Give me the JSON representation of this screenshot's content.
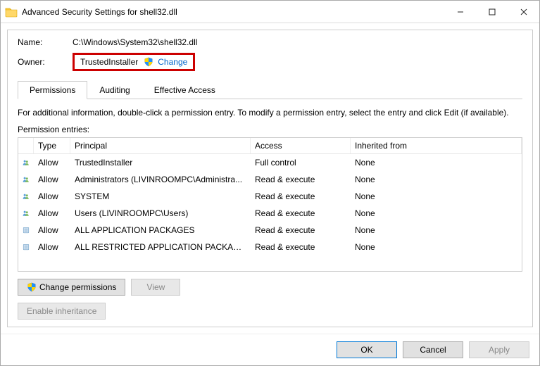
{
  "window": {
    "title": "Advanced Security Settings for shell32.dll"
  },
  "fields": {
    "name_label": "Name:",
    "name_value": "C:\\Windows\\System32\\shell32.dll",
    "owner_label": "Owner:",
    "owner_value": "TrustedInstaller",
    "change_link": "Change"
  },
  "tabs": {
    "permissions": "Permissions",
    "auditing": "Auditing",
    "effective": "Effective Access"
  },
  "info_text": "For additional information, double-click a permission entry. To modify a permission entry, select the entry and click Edit (if available).",
  "entries_label": "Permission entries:",
  "columns": {
    "type": "Type",
    "principal": "Principal",
    "access": "Access",
    "inherited": "Inherited from"
  },
  "entries": [
    {
      "icon": "users",
      "type": "Allow",
      "principal": "TrustedInstaller",
      "access": "Full control",
      "inherited": "None"
    },
    {
      "icon": "users",
      "type": "Allow",
      "principal": "Administrators (LIVINROOMPC\\Administra...",
      "access": "Read & execute",
      "inherited": "None"
    },
    {
      "icon": "users",
      "type": "Allow",
      "principal": "SYSTEM",
      "access": "Read & execute",
      "inherited": "None"
    },
    {
      "icon": "users",
      "type": "Allow",
      "principal": "Users (LIVINROOMPC\\Users)",
      "access": "Read & execute",
      "inherited": "None"
    },
    {
      "icon": "package",
      "type": "Allow",
      "principal": "ALL APPLICATION PACKAGES",
      "access": "Read & execute",
      "inherited": "None"
    },
    {
      "icon": "package",
      "type": "Allow",
      "principal": "ALL RESTRICTED APPLICATION PACKAGES",
      "access": "Read & execute",
      "inherited": "None"
    }
  ],
  "buttons": {
    "change_permissions": "Change permissions",
    "view": "View",
    "enable_inheritance": "Enable inheritance",
    "ok": "OK",
    "cancel": "Cancel",
    "apply": "Apply"
  }
}
